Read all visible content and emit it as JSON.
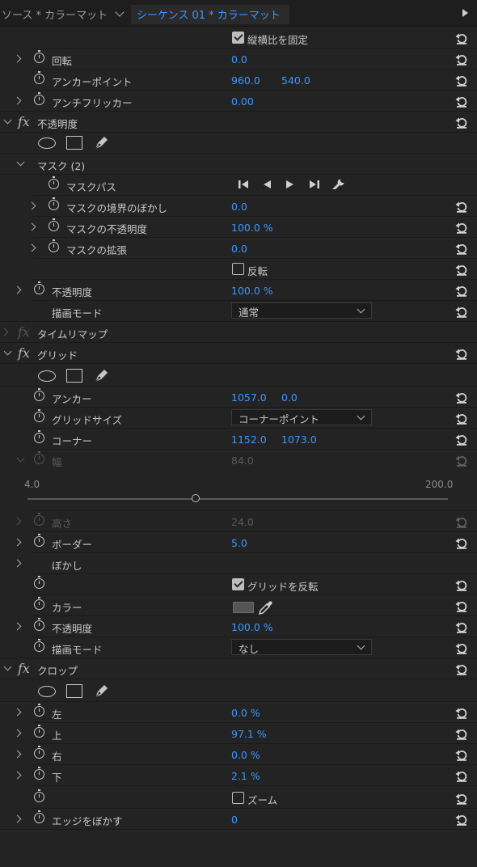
{
  "header": {
    "source_tab": "ソース * カラーマット",
    "sequence_tab": "シーケンス 01 * カラーマット"
  },
  "rows": {
    "lock_aspect": "縦横比を固定",
    "rotation": {
      "label": "回転",
      "value": "0.0"
    },
    "anchor_point": {
      "label": "アンカーポイント",
      "x": "960.0",
      "y": "540.0"
    },
    "anti_flicker": {
      "label": "アンチフリッカー",
      "value": "0.00"
    },
    "opacity_fx": "不透明度",
    "mask_group": "マスク (2)",
    "mask_path": "マスクパス",
    "mask_feather": {
      "label": "マスクの境界のぼかし",
      "value": "0.0"
    },
    "mask_opacity": {
      "label": "マスクの不透明度",
      "value": "100.0 %"
    },
    "mask_expansion": {
      "label": "マスクの拡張",
      "value": "0.0"
    },
    "invert_label": "反転",
    "opacity": {
      "label": "不透明度",
      "value": "100.0 %"
    },
    "blend_mode": {
      "label": "描画モード",
      "value": "通常"
    },
    "time_remap": "タイムリマップ",
    "grid_fx": "グリッド",
    "grid_anchor": {
      "label": "アンカー",
      "x": "1057.0",
      "y": "0.0"
    },
    "grid_size": {
      "label": "グリッドサイズ",
      "value": "コーナーポイント"
    },
    "corner": {
      "label": "コーナー",
      "x": "1152.0",
      "y": "1073.0"
    },
    "width": {
      "label": "幅",
      "value": "84.0"
    },
    "slider": {
      "min": "4.0",
      "max": "200.0",
      "level": 0.4
    }
  },
  "rows2": {
    "height": {
      "label": "高さ",
      "value": "24.0"
    },
    "border": {
      "label": "ボーダー",
      "value": "5.0"
    },
    "feather": {
      "label": "ぼかし"
    },
    "invert_grid": "グリッドを反転",
    "color": {
      "label": "カラー",
      "swatch": "#555555"
    },
    "opacity2": {
      "label": "不透明度",
      "value": "100.0 %"
    },
    "blend2": {
      "label": "描画モード",
      "value": "なし"
    },
    "crop_fx": "クロップ",
    "left": {
      "label": "左",
      "value": "0.0 %"
    },
    "top": {
      "label": "上",
      "value": "97.1 %"
    },
    "right": {
      "label": "右",
      "value": "0.0 %"
    },
    "bottom": {
      "label": "下",
      "value": "2.1 %"
    },
    "zoom": "ズーム",
    "edge_feather": {
      "label": "エッジをぼかす",
      "value": "0"
    }
  },
  "colors": {
    "accent": "#3d97ff",
    "bg": "#232323"
  }
}
